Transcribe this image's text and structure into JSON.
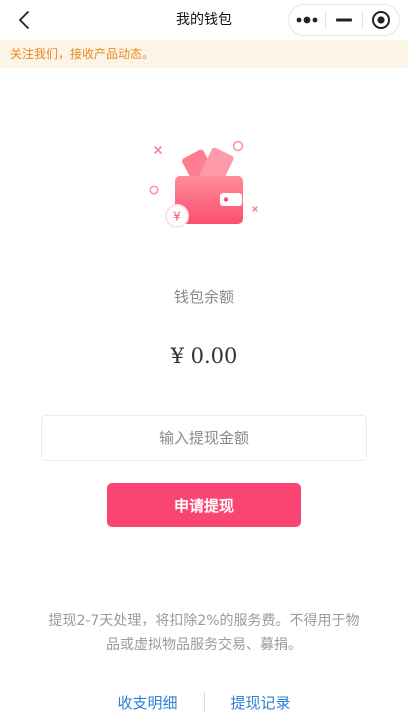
{
  "nav": {
    "title": "我的钱包",
    "back_icon": "chevron-left-icon",
    "menu_icon": "more-dots-icon",
    "minimize_icon": "minimize-icon",
    "close_icon": "target-close-icon"
  },
  "notice": {
    "text": "关注我们，接收产品动态。"
  },
  "wallet": {
    "icon": "wallet-icon",
    "currency_badge": "¥",
    "balance_label": "钱包余额",
    "balance_amount": "¥ 0.00"
  },
  "withdraw": {
    "input_placeholder": "输入提现金额",
    "input_value": "",
    "button_label": "申请提现"
  },
  "footnote": "提现2-7天处理，将扣除2%的服务费。不得用于物品或虚拟物品服务交易、募捐。",
  "footer": {
    "link_left": "收支明细",
    "link_right": "提现记录"
  },
  "colors": {
    "accent": "#fa4471",
    "notice_bg": "#fdf4e8",
    "notice_text": "#e58b1c",
    "link": "#2b7fd6"
  }
}
